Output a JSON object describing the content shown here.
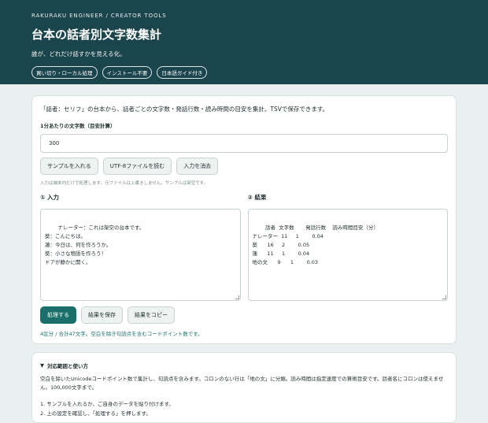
{
  "header": {
    "kicker": "RAKURAKU ENGINEER / CREATOR TOOLS",
    "title": "台本の話者別文字数集計",
    "tagline": "誰が、どれだけ話すかを見える化。",
    "badges": [
      "買い切り・ローカル処理",
      "インストール不要",
      "日本語ガイド付き"
    ]
  },
  "main": {
    "intro": "「話者：セリフ」の台本から、話者ごとの文字数・発話行数・読み時間の目安を集計。TSVで保存できます。",
    "wpm_label": "1分あたりの文字数（目安計算）",
    "wpm_value": "300",
    "buttons": {
      "sample": "サンプルを入れる",
      "load": "UTF-8ファイルを読む",
      "clear": "入力を消去"
    },
    "note": "入力は端末内だけで処理します。元ファイルは上書きしません。サンプルは架空です。",
    "input_heading": "① 入力",
    "result_heading": "② 結果",
    "input_text": "ナレーター：これは架空の台本です。\n葵：こんにちは。\n蓮：今日は、何を作ろうか。\n葵：小さな物語を作ろう！\nドアが静かに開く。",
    "result_text": "話者  文字数       発話行数    読み時間目安（分）\nナレーター  11     1        0.04\n葵      16     2        0.05\n蓮      11     1        0.04\n地の文      9      1        0.03",
    "actions": {
      "process": "処理する",
      "save": "結果を保存",
      "copy": "結果をコピー"
    },
    "summary": "4区分 / 合計47文字。空白を除き句読点を含むコードポイント数です。"
  },
  "help": {
    "toggle_icon": "triangle-down",
    "title": "対応範囲と使い方",
    "text": "空白を除いたUnicodeコードポイント数で集計し、句読点を含みます。コロンのない行は「地の文」に分類。読み時間は指定速度での算術目安です。話者名にコロンは使えません。100,000文字まで。",
    "step1": "1. サンプルを入れるか、ご自身のデータを貼り付けます。",
    "step2": "2. 上の設定を確認し、「処理する」を押します。"
  }
}
